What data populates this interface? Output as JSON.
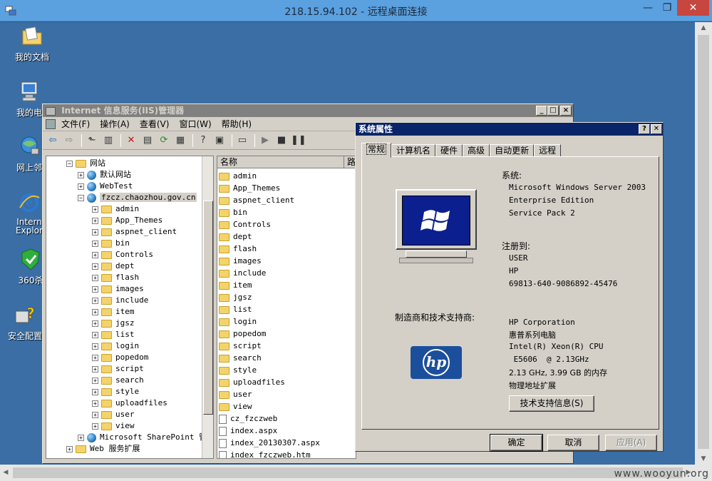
{
  "rdp": {
    "title": "218.15.94.102 - 远程桌面连接",
    "minimize": "—",
    "restore": "❐",
    "close": "✕",
    "watermark": "www.wooyun.org"
  },
  "desktop_icons": [
    {
      "label": "我的文档",
      "icon": "folder-documents-icon"
    },
    {
      "label": "我的电",
      "icon": "my-computer-icon"
    },
    {
      "label": "网上邻",
      "icon": "network-icon"
    },
    {
      "label": "Intern\nExplor",
      "icon": "internet-explorer-icon"
    },
    {
      "label": "360杀",
      "icon": "shield-icon"
    },
    {
      "label": "安全配置",
      "icon": "security-config-icon"
    }
  ],
  "iis": {
    "title": "Internet 信息服务(IIS)管理器",
    "menu": [
      "文件(F)",
      "操作(A)",
      "查看(V)",
      "窗口(W)",
      "帮助(H)"
    ],
    "tree": {
      "root": "网站",
      "sites": [
        "默认网站",
        "WebTest",
        "fzcz.chaozhou.gov.cn"
      ],
      "folders": [
        "admin",
        "App_Themes",
        "aspnet_client",
        "bin",
        "Controls",
        "dept",
        "flash",
        "images",
        "include",
        "item",
        "jgsz",
        "list",
        "login",
        "popedom",
        "script",
        "search",
        "style",
        "uploadfiles",
        "user",
        "view"
      ],
      "sharepoint": "Microsoft SharePoint 管",
      "web_ext": "Web 服务扩展"
    },
    "list": {
      "col_name": "名称",
      "col_path": "路",
      "folders": [
        "admin",
        "App_Themes",
        "aspnet_client",
        "bin",
        "Controls",
        "dept",
        "flash",
        "images",
        "include",
        "item",
        "jgsz",
        "list",
        "login",
        "popedom",
        "script",
        "search",
        "style",
        "uploadfiles",
        "user",
        "view"
      ],
      "files": [
        "cz_fzczweb",
        "index.aspx",
        "index_20130307.aspx",
        "index_fzczweb.htm"
      ]
    }
  },
  "sysprop": {
    "title": "系统属性",
    "help": "?",
    "close": "✕",
    "tabs": [
      "常规",
      "计算机名",
      "硬件",
      "高级",
      "自动更新",
      "远程"
    ],
    "system_label": "系统:",
    "os": [
      "Microsoft Windows Server 2003",
      "Enterprise Edition",
      "Service Pack 2"
    ],
    "registered_label": "注册到:",
    "registered": [
      "USER",
      "HP",
      "69813-640-9086892-45476"
    ],
    "maker_label": "制造商和技术支持商:",
    "maker": [
      "HP Corporation",
      "惠普系列电脑",
      "Intel(R) Xeon(R) CPU",
      " E5606  @ 2.13GHz",
      "2.13 GHz, 3.99 GB 的内存",
      "物理地址扩展"
    ],
    "support_btn": "技术支持信息(S)",
    "hp_logo": "hp",
    "ok": "确定",
    "cancel": "取消",
    "apply": "应用(A)"
  }
}
